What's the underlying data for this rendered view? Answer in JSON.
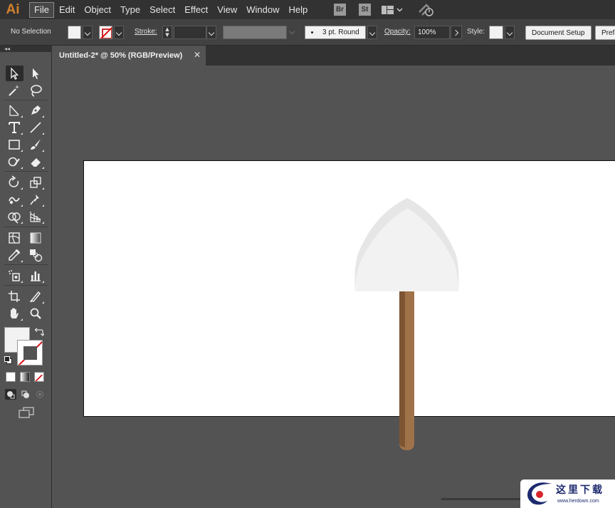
{
  "app": {
    "logo": "Ai"
  },
  "menu": [
    "File",
    "Edit",
    "Object",
    "Type",
    "Select",
    "Effect",
    "View",
    "Window",
    "Help"
  ],
  "menu_active": "File",
  "bridge": {
    "br": "Br",
    "st": "St"
  },
  "control": {
    "selection": "No Selection",
    "stroke_label": "Stroke:",
    "brush": "3 pt. Round",
    "opacity_label": "Opacity:",
    "opacity_value": "100%",
    "style_label": "Style:",
    "document_setup": "Document Setup",
    "preferences": "Preferences"
  },
  "document": {
    "tab_title": "Untitled-2* @ 50% (RGB/Preview)",
    "close": "✕"
  },
  "colors": {
    "fill": "#f2f2f2",
    "stroke": "none",
    "shovel_blade": "#f2f2f2",
    "shovel_blade_shade": "#e6e6e6",
    "handle": "#a0724a",
    "handle_dark": "#7d5533"
  },
  "watermark": {
    "text": "这里下载",
    "url": "www.herdown.com"
  }
}
